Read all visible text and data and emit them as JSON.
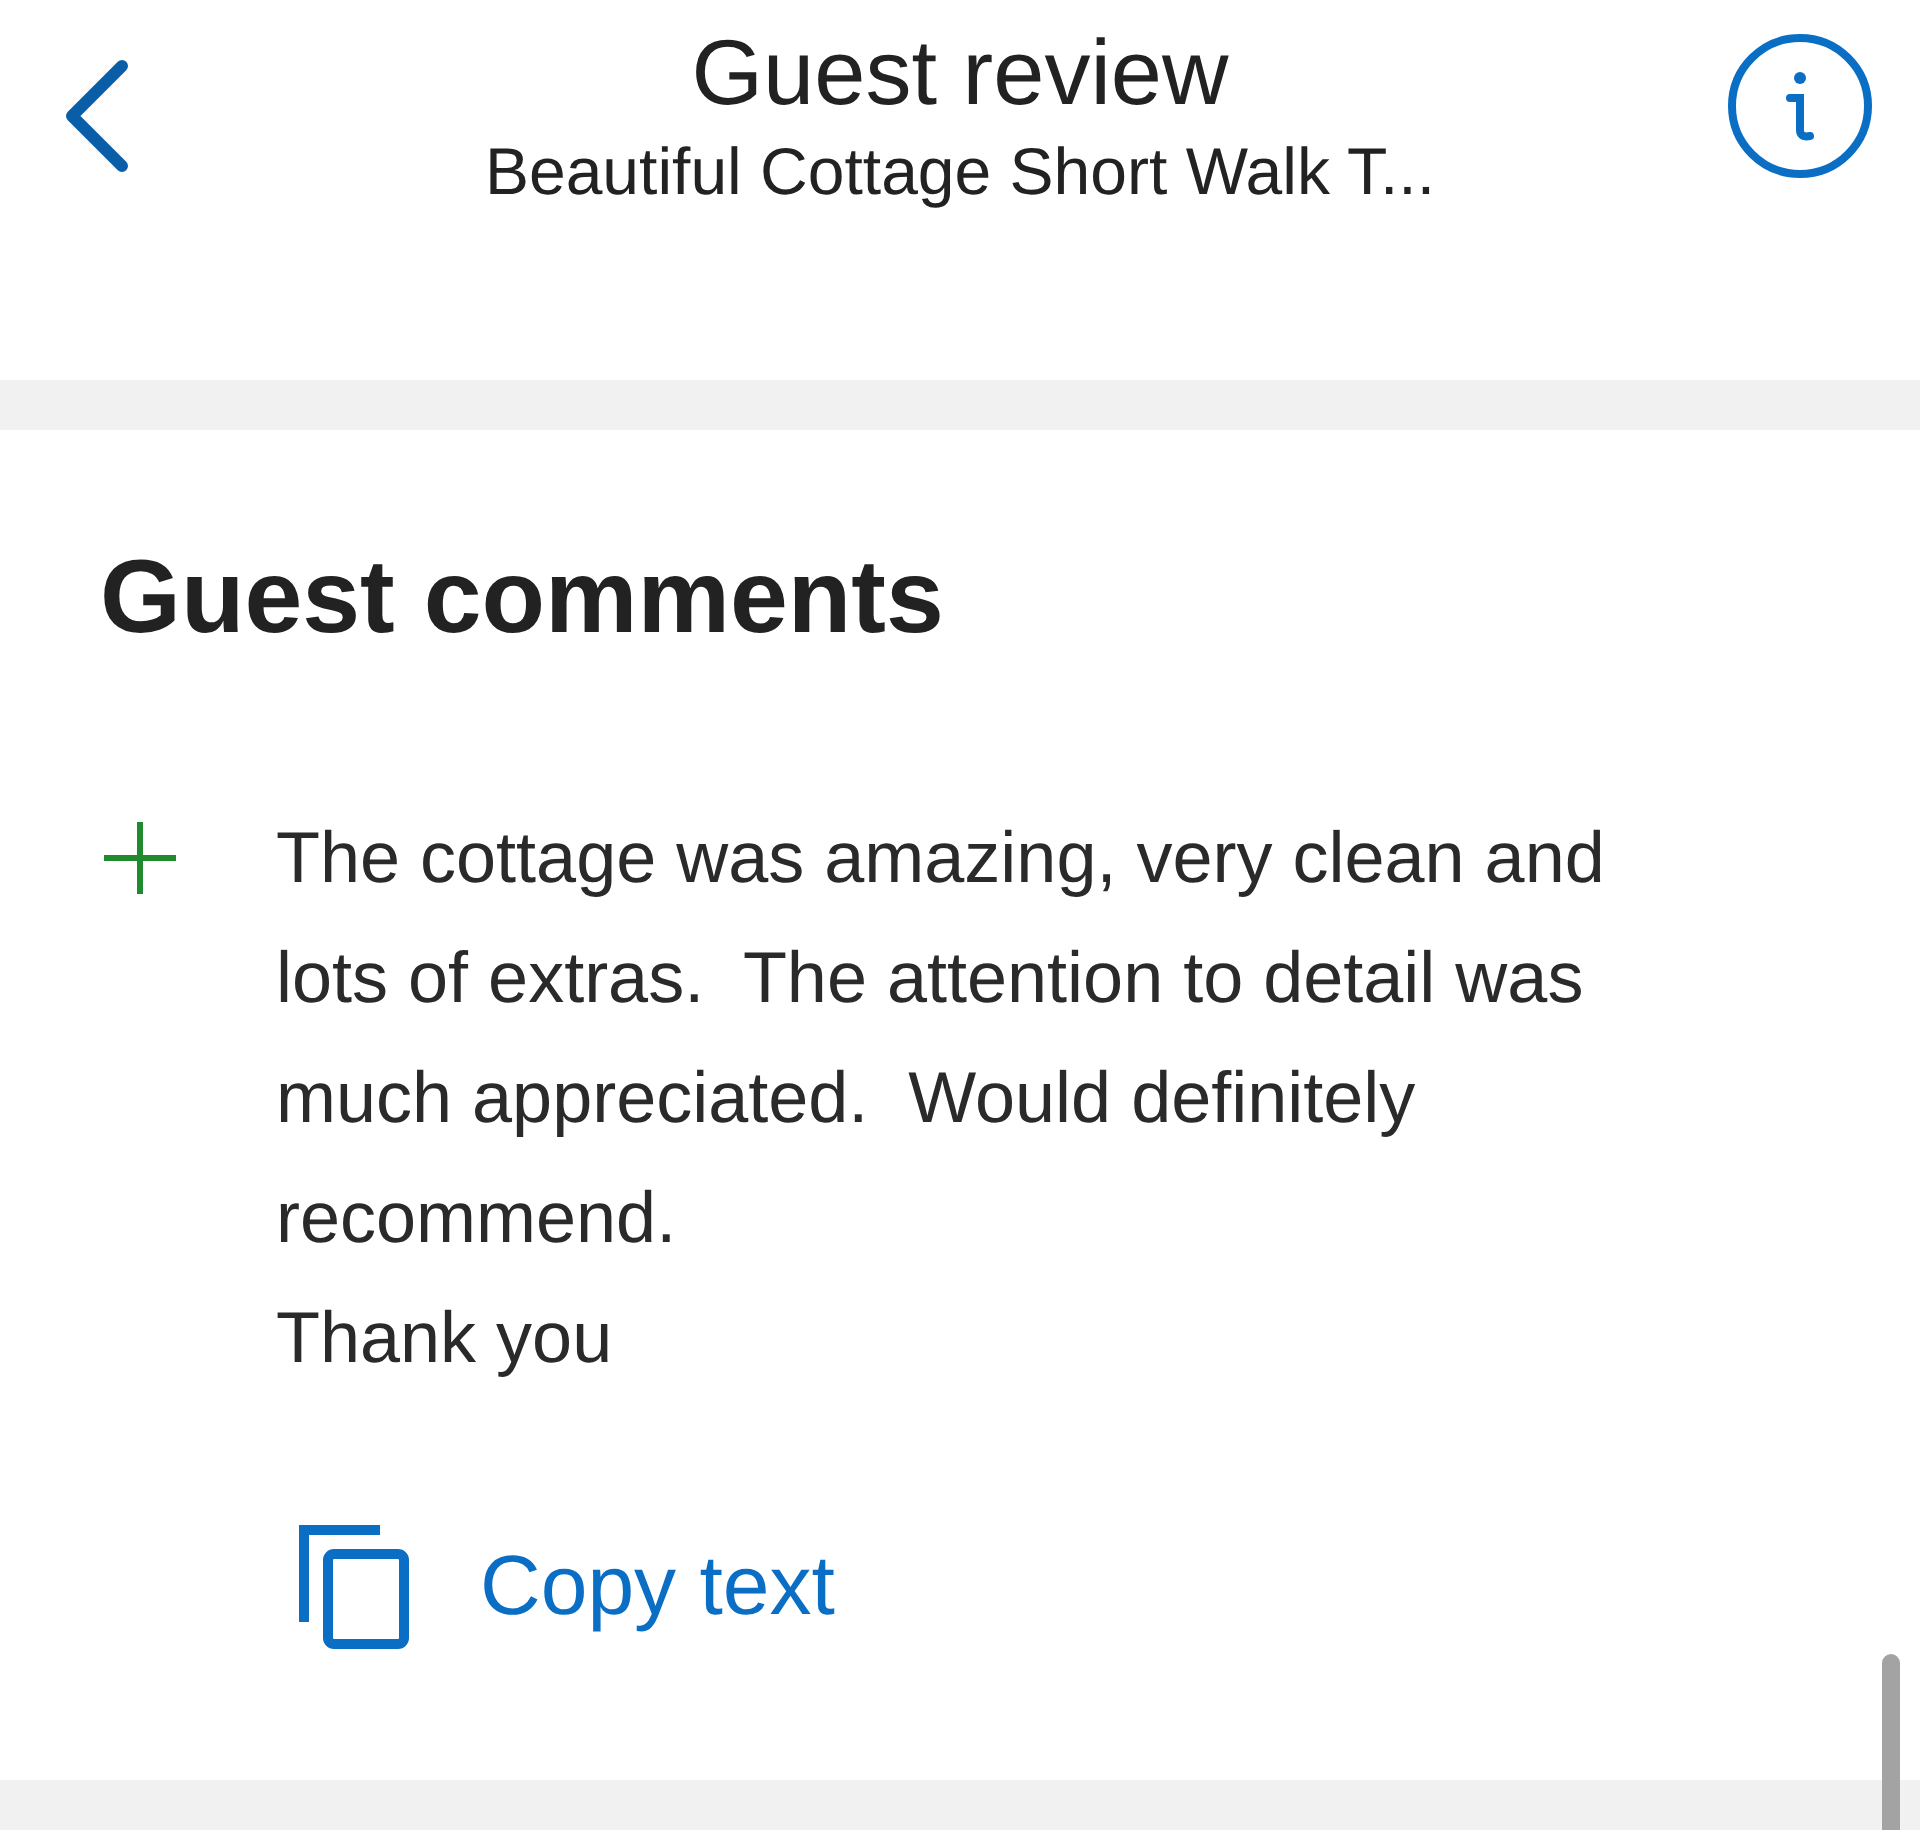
{
  "header": {
    "title": "Guest review",
    "subtitle": "Beautiful Cottage Short Walk T..."
  },
  "comments": {
    "heading": "Guest comments",
    "items": [
      {
        "kind": "positive",
        "text": "The cottage was amazing, very clean and lots of extras.  The attention to detail was much appreciated.  Would definitely recommend.\nThank you"
      }
    ],
    "copy_label": "Copy text"
  }
}
